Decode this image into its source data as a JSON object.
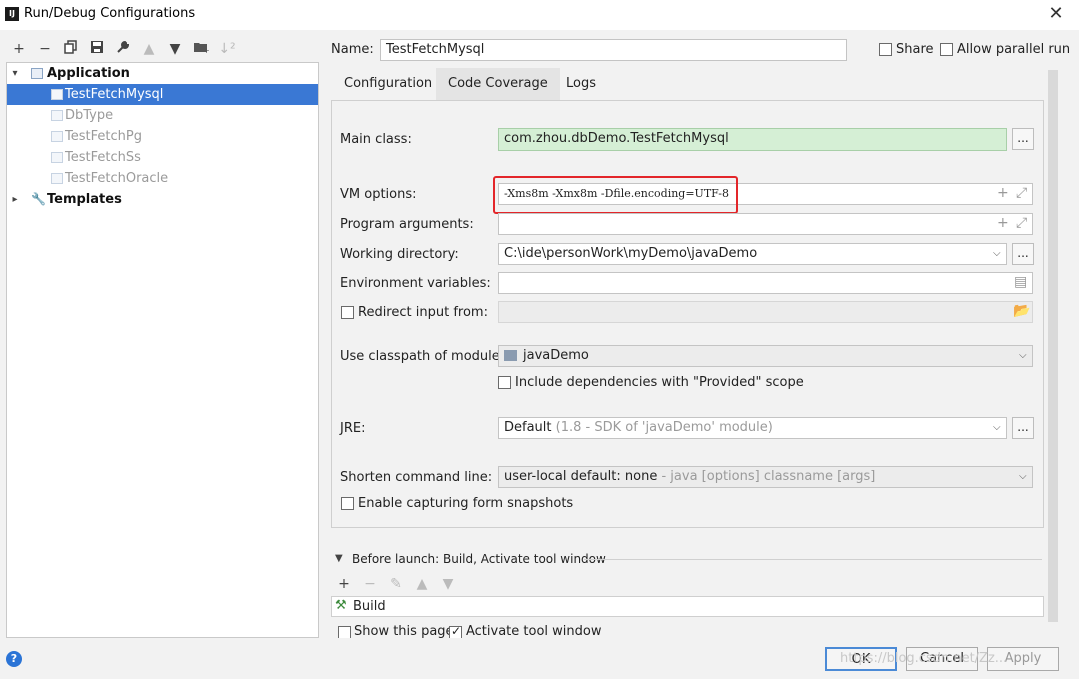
{
  "window": {
    "title": "Run/Debug Configurations",
    "app_icon_text": "IJ"
  },
  "toolbar": {
    "icons": [
      "plus-icon",
      "minus-icon",
      "copy-icon",
      "save-icon",
      "wrench-icon",
      "arrow-up-icon",
      "arrow-down-icon",
      "folder-add-icon",
      "sort-icon"
    ]
  },
  "tree": {
    "application_label": "Application",
    "items": [
      "TestFetchMysql",
      "DbType",
      "TestFetchPg",
      "TestFetchSs",
      "TestFetchOracle"
    ],
    "templates_label": "Templates"
  },
  "header": {
    "name_label": "Name:",
    "name_value": "TestFetchMysql",
    "share_label": "Share",
    "allow_parallel_label": "Allow parallel run"
  },
  "tabs": [
    "Configuration",
    "Code Coverage",
    "Logs"
  ],
  "form": {
    "main_class_label": "Main class:",
    "main_class_value": "com.zhou.dbDemo.TestFetchMysql",
    "vm_options_label": "VM options:",
    "vm_options_value": "-Xms8m -Xmx8m -Dfile.encoding=UTF-8",
    "program_args_label": "Program arguments:",
    "working_dir_label": "Working directory:",
    "working_dir_value": "C:\\ide\\personWork\\myDemo\\javaDemo",
    "env_vars_label": "Environment variables:",
    "redirect_label": "Redirect input from:",
    "classpath_label": "Use classpath of module:",
    "classpath_value": "javaDemo",
    "include_deps_label": "Include dependencies with \"Provided\" scope",
    "jre_label": "JRE:",
    "jre_value": "Default",
    "jre_hint": "(1.8 - SDK of 'javaDemo' module)",
    "shorten_label": "Shorten command line:",
    "shorten_value": "user-local default: none",
    "shorten_hint": "- java [options] classname [args]",
    "snapshots_label": "Enable capturing form snapshots",
    "dots": "..."
  },
  "before_launch": {
    "header": "Before launch: Build, Activate tool window",
    "build_item": "Build",
    "show_page_label": "Show this page",
    "activate_label": "Activate tool window"
  },
  "footer": {
    "help": "?",
    "ok": "OK",
    "cancel": "Cancel",
    "apply": "Apply",
    "watermark": "https://blog.csdn.net/Zz..."
  },
  "colors": {
    "selection": "#3a78d4",
    "main_class_bg": "#d5efd5",
    "highlight_box": "#e3262a",
    "ok_border": "#4b8ad6"
  }
}
